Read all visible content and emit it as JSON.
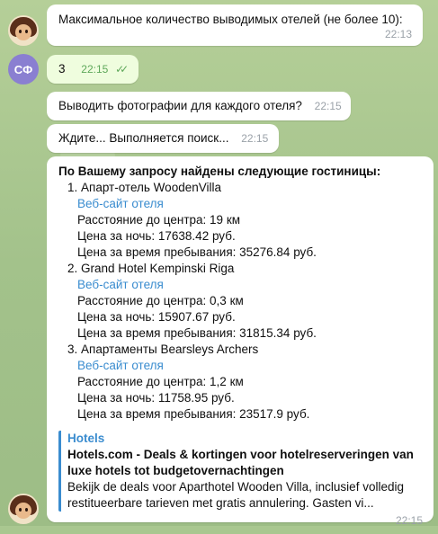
{
  "messages": {
    "m1": {
      "text": "Максимальное количество выводимых отелей (не более 10):",
      "time": "22:13"
    },
    "m2": {
      "text": "3",
      "time": "22:15"
    },
    "m3": {
      "text": "Выводить фотографии для каждого отеля?",
      "time": "22:15"
    },
    "m4": {
      "text": "Ждите... Выполняется поиск...",
      "time": "22:15"
    },
    "m5": {
      "heading": "По Вашему запросу найдены следующие гостиницы:",
      "hotels": [
        {
          "name": "1. Апарт-отель WoodenVilla",
          "link": "Веб-сайт отеля",
          "distance": "Расстояние до центра: 19 км",
          "price_night": "Цена за ночь: 17638.42 руб.",
          "price_total": "Цена за время пребывания: 35276.84 руб."
        },
        {
          "name": "2. Grand Hotel Kempinski Riga",
          "link": "Веб-сайт отеля",
          "distance": "Расстояние до центра: 0,3 км",
          "price_night": "Цена за ночь: 15907.67 руб.",
          "price_total": "Цена за время пребывания: 31815.34 руб."
        },
        {
          "name": "3. Апартаменты Bearsleys Archers",
          "link": "Веб-сайт отеля",
          "distance": "Расстояние до центра: 1,2 км",
          "price_night": "Цена за ночь: 11758.95 руб.",
          "price_total": "Цена за время пребывания: 23517.9 руб."
        }
      ],
      "preview": {
        "site": "Hotels",
        "title": "Hotels.com - Deals & kortingen voor hotelreserveringen van luxe hotels tot budgetovernachtingen",
        "description": "Bekijk de deals voor Aparthotel Wooden Villa, inclusief volledig restitueerbare tarieven met gratis annulering. Gasten vi..."
      },
      "time": "22:15"
    }
  },
  "user": {
    "initials": "СФ",
    "avatar_color": "#8a7fd1"
  },
  "colors": {
    "link": "#3a8ccf",
    "outgoing_bubble": "#effdde",
    "read_checks": "#5ea85a"
  }
}
